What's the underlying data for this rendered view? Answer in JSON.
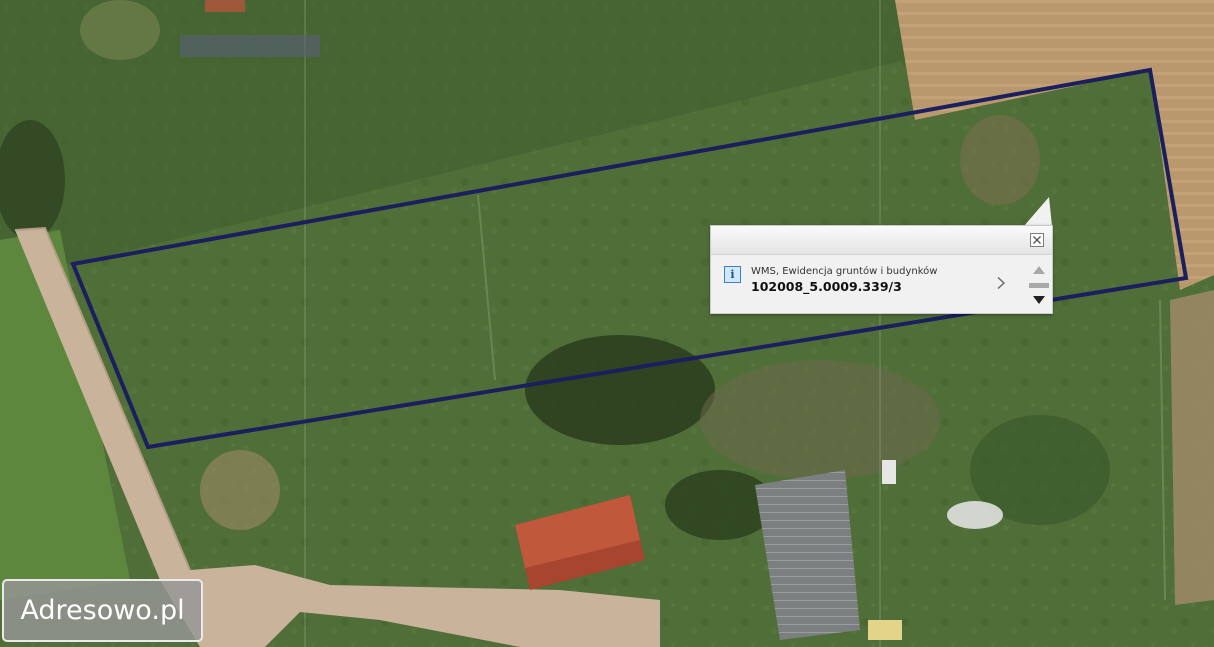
{
  "map": {
    "basemap": "aerial-orthophoto",
    "parcel_outline_color": "#1b1f5e"
  },
  "popup": {
    "layer_name": "WMS, Ewidencja gruntów i budynków",
    "parcel_id": "102008_5.0009.339/3",
    "info_icon_glyph": "i",
    "close_icon": "close-icon",
    "next_icon": "chevron-right-icon",
    "scroll_up_icon": "triangle-up-icon",
    "scroll_down_icon": "triangle-down-icon"
  },
  "watermark": {
    "text": "Adresowo.pl"
  }
}
